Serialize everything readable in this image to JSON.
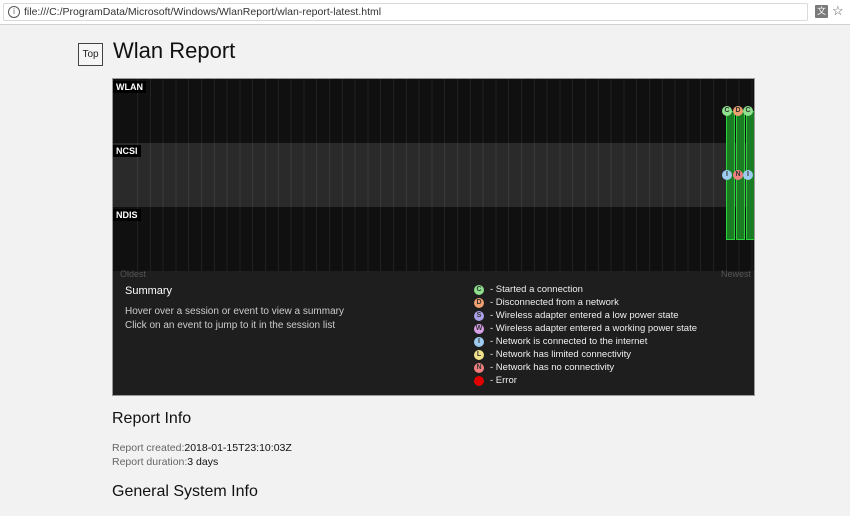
{
  "browser": {
    "url": "file:///C:/ProgramData/Microsoft/Windows/WlanReport/wlan-report-latest.html",
    "info_glyph": "i",
    "translate_glyph": "文",
    "star_glyph": "☆"
  },
  "page": {
    "top_button": "Top",
    "title": "Wlan Report"
  },
  "timeline": {
    "bands": [
      "WLAN",
      "NCSI",
      "NDIS"
    ],
    "oldest_label": "Oldest",
    "newest_label": "Newest",
    "events": [
      {
        "letter": "C",
        "color": "#8fe08f",
        "row": "WLAN"
      },
      {
        "letter": "D",
        "color": "#f0a070",
        "row": "WLAN"
      },
      {
        "letter": "C",
        "color": "#8fe08f",
        "row": "WLAN"
      },
      {
        "letter": "I",
        "color": "#9ecbf0",
        "row": "NCSI"
      },
      {
        "letter": "N",
        "color": "#f08080",
        "row": "NCSI"
      },
      {
        "letter": "I",
        "color": "#9ecbf0",
        "row": "NCSI"
      }
    ],
    "colors": {
      "session_fill": "#1a7d24",
      "session_border": "#2bd03c"
    }
  },
  "summary": {
    "title": "Summary",
    "lines": [
      "Hover over a session or event to view a summary",
      "Click on an event to jump to it in the session list"
    ]
  },
  "legend": [
    {
      "letter": "C",
      "color": "#8fe08f",
      "text": "- Started a connection"
    },
    {
      "letter": "D",
      "color": "#f0a070",
      "text": "- Disconnected from a network"
    },
    {
      "letter": "S",
      "color": "#a9a0e8",
      "text": "- Wireless adapter entered a low power state"
    },
    {
      "letter": "W",
      "color": "#d8a0e8",
      "text": "- Wireless adapter entered a working power state"
    },
    {
      "letter": "I",
      "color": "#9ecbf0",
      "text": "- Network is connected to the internet"
    },
    {
      "letter": "L",
      "color": "#f0e08a",
      "text": "- Network has limited connectivity"
    },
    {
      "letter": "N",
      "color": "#f08080",
      "text": "- Network has no connectivity"
    },
    {
      "letter": "",
      "color": "#e00000",
      "text": "- Error"
    }
  ],
  "report_info": {
    "title": "Report Info",
    "created_label": "Report created:",
    "created_value": "2018-01-15T23:10:03Z",
    "duration_label": "Report duration:",
    "duration_value": "3 days"
  },
  "general_system": {
    "title": "General System Info"
  }
}
